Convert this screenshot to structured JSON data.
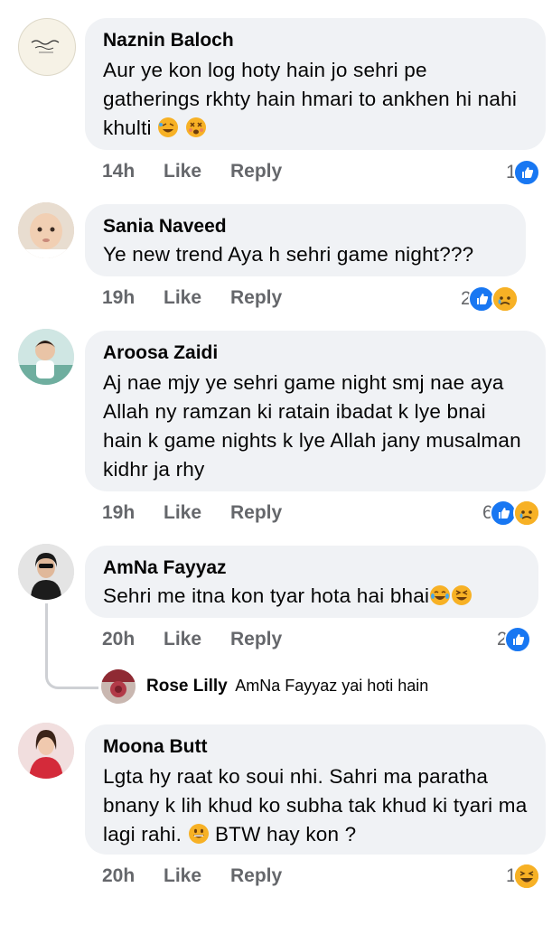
{
  "comments": [
    {
      "author": "Naznin Baloch",
      "text": "Aur ye kon log hoty hain jo sehri pe gatherings rkhty hain hmari to ankhen hi nahi khulti",
      "time": "14h",
      "like": "Like",
      "reply": "Reply",
      "reaction_count": "1",
      "reactions": [
        "like"
      ]
    },
    {
      "author": "Sania Naveed",
      "text": "Ye new trend Aya h sehri game night???",
      "time": "19h",
      "like": "Like",
      "reply": "Reply",
      "reaction_count": "2",
      "reactions": [
        "like",
        "sad"
      ]
    },
    {
      "author": "Aroosa Zaidi",
      "text": "Aj nae mjy ye sehri game night smj nae aya Allah ny ramzan ki ratain ibadat k lye bnai hain k game nights k lye Allah jany musalman kidhr ja rhy",
      "time": "19h",
      "like": "Like",
      "reply": "Reply",
      "reaction_count": "6",
      "reactions": [
        "like",
        "sad"
      ]
    },
    {
      "author": "AmNa Fayyaz",
      "text": "Sehri me itna kon tyar hota hai bhai",
      "time": "20h",
      "like": "Like",
      "reply": "Reply",
      "reaction_count": "2",
      "reactions": [
        "like"
      ]
    },
    {
      "author": "Moona Butt",
      "text": "Lgta hy raat ko soui nhi. Sahri ma paratha bnany k lih khud ko subha tak khud ki tyari ma lagi rahi.",
      "text_after_emoji": "BTW hay kon ?",
      "time": "20h",
      "like": "Like",
      "reply": "Reply",
      "reaction_count": "1",
      "reactions": [
        "haha"
      ]
    }
  ],
  "reply_preview": {
    "author": "Rose Lilly",
    "text": "AmNa Fayyaz yai hoti hain"
  },
  "colors": {
    "bubble": "#f0f2f5",
    "meta_text": "#65676b",
    "like_blue": "#1877f2",
    "emoji_yellow": "#f7b125"
  }
}
